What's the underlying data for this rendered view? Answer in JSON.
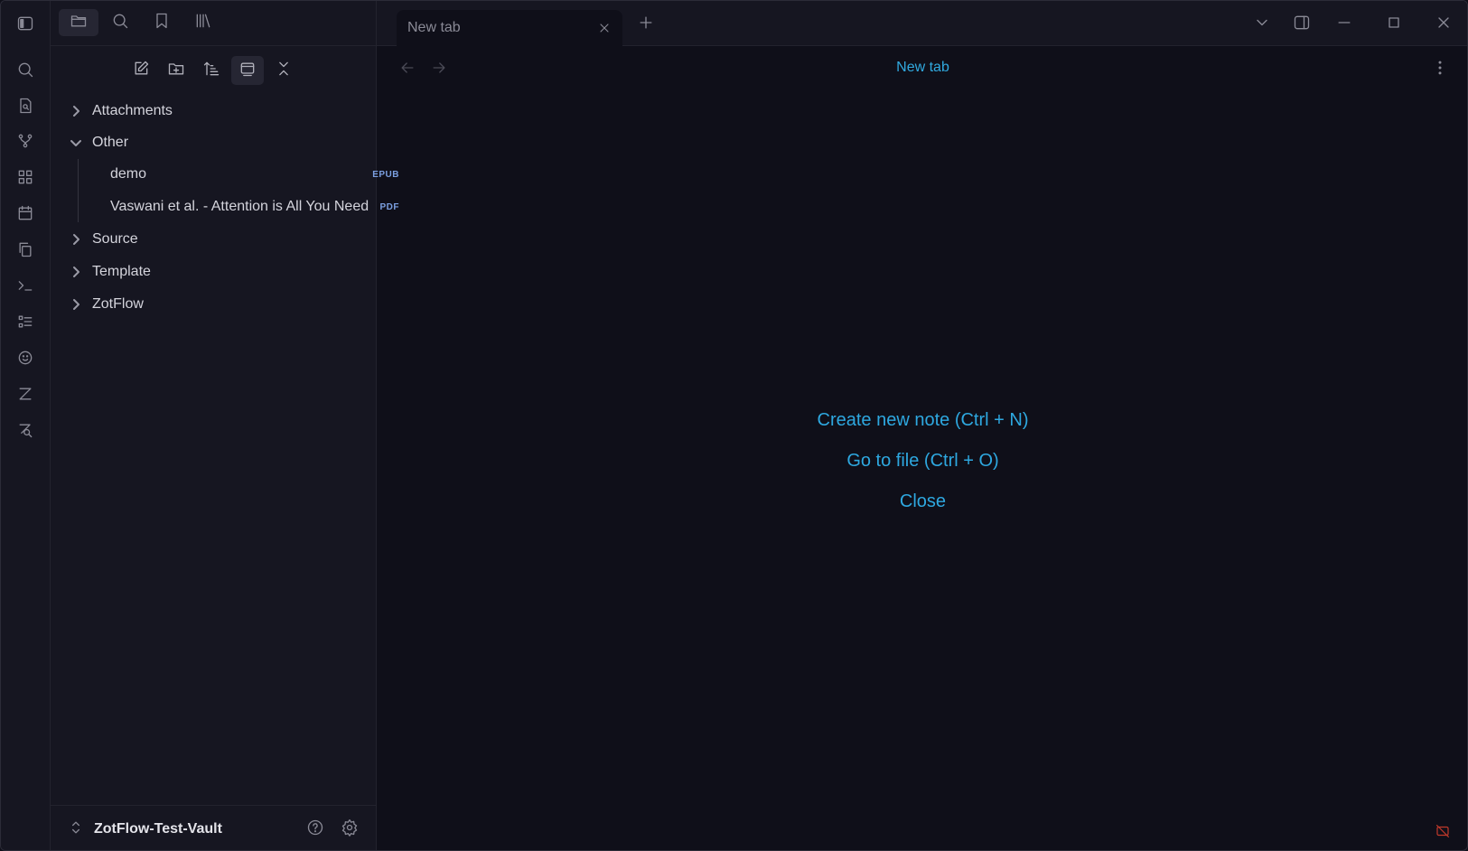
{
  "sidebar_tabs": [
    {
      "icon": "folder-icon"
    },
    {
      "icon": "search-icon"
    },
    {
      "icon": "bookmark-icon"
    },
    {
      "icon": "library-icon"
    }
  ],
  "ribbon": [
    {
      "icon": "search-icon"
    },
    {
      "icon": "file-search-icon"
    },
    {
      "icon": "git-branch-icon"
    },
    {
      "icon": "dashboard-icon"
    },
    {
      "icon": "calendar-icon"
    },
    {
      "icon": "copy-icon"
    },
    {
      "icon": "terminal-icon"
    },
    {
      "icon": "list-icon"
    },
    {
      "icon": "smiley-icon"
    },
    {
      "icon": "zotero-icon"
    },
    {
      "icon": "zotero-search-icon"
    }
  ],
  "file_nav": [
    {
      "icon": "new-note-icon"
    },
    {
      "icon": "new-folder-icon"
    },
    {
      "icon": "sort-icon"
    },
    {
      "icon": "auto-reveal-icon"
    },
    {
      "icon": "collapse-all-icon"
    }
  ],
  "tree": {
    "attachments": "Attachments",
    "other": "Other",
    "demo": "demo",
    "demo_badge": "EPUB",
    "vaswani": "Vaswani et al. - Attention is All You Need",
    "vaswani_badge": "PDF",
    "source": "Source",
    "template": "Template",
    "zotflow": "ZotFlow"
  },
  "footer": {
    "vault_name": "ZotFlow-Test-Vault"
  },
  "tab": {
    "title": "New tab"
  },
  "view": {
    "title": "New tab"
  },
  "empty_state": {
    "create": "Create new note (Ctrl + N)",
    "goto": "Go to file (Ctrl + O)",
    "close": "Close"
  },
  "colors": {
    "accent": "#2ea8e0",
    "background": "#0f0f19",
    "sidebar": "#161621",
    "badge": "#7b9fe0"
  }
}
